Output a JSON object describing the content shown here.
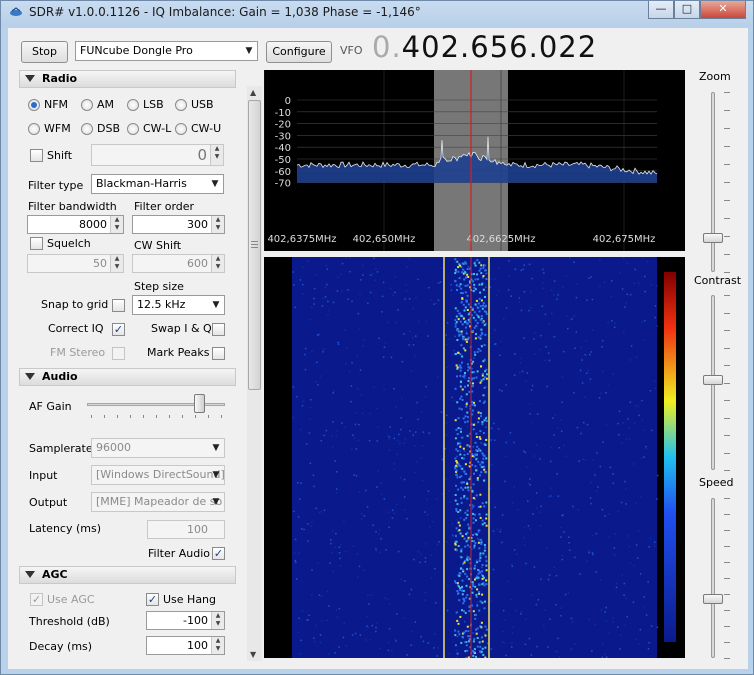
{
  "window": {
    "title": "SDR# v1.0.0.1126 - IQ Imbalance: Gain = 1,038 Phase = -1,146°",
    "minimize": "—",
    "maximize": "□",
    "close": "✕"
  },
  "toolbar": {
    "stop_label": "Stop",
    "device": "FUNcube Dongle Pro",
    "configure_label": "Configure",
    "vfo_label": "VFO",
    "vfo_leading": "0.",
    "vfo_value": "402.656.022"
  },
  "radio": {
    "section_title": "Radio",
    "modes": [
      "NFM",
      "AM",
      "LSB",
      "USB",
      "WFM",
      "DSB",
      "CW-L",
      "CW-U"
    ],
    "selected_mode": "NFM",
    "shift_label": "Shift",
    "shift_value": "0",
    "filter_type_label": "Filter type",
    "filter_type": "Blackman-Harris",
    "filter_bandwidth_label": "Filter bandwidth",
    "filter_bandwidth": "8000",
    "filter_order_label": "Filter order",
    "filter_order": "300",
    "squelch_label": "Squelch",
    "squelch_value": "50",
    "cw_shift_label": "CW Shift",
    "cw_shift_value": "600",
    "step_size_label": "Step size",
    "step_size": "12.5 kHz",
    "snap_to_grid_label": "Snap to grid",
    "correct_iq_label": "Correct IQ",
    "swap_iq_label": "Swap I & Q",
    "fm_stereo_label": "FM Stereo",
    "mark_peaks_label": "Mark Peaks",
    "check_mark": "✓"
  },
  "audio": {
    "section_title": "Audio",
    "af_gain_label": "AF Gain",
    "af_gain_level": 0.85,
    "samplerate_label": "Samplerate",
    "samplerate": "96000",
    "input_label": "Input",
    "input": "[Windows DirectSound]",
    "output_label": "Output",
    "output": "[MME] Mapeador de so",
    "latency_label": "Latency (ms)",
    "latency": "100",
    "filter_audio_label": "Filter Audio"
  },
  "agc": {
    "section_title": "AGC",
    "use_agc_label": "Use AGC",
    "use_hang_label": "Use Hang",
    "threshold_label": "Threshold (dB)",
    "threshold": "-100",
    "decay_label": "Decay (ms)",
    "decay": "100"
  },
  "spectrum": {
    "y_ticks": [
      "0",
      "-10",
      "-20",
      "-30",
      "-40",
      "-50",
      "-60",
      "-70"
    ],
    "freq_labels": [
      "402,6375MHz",
      "402,650MHz",
      "402,6625MHz",
      "402,675MHz"
    ]
  },
  "side_controls": {
    "zoom_label": "Zoom",
    "contrast_label": "Contrast",
    "speed_label": "Speed"
  },
  "colors": {
    "spectrum_fill": "#1d3f8f",
    "filter_band": "#8c8c8c",
    "vfo_marker": "#d22020",
    "waterfall_bg": "#0a1a8c"
  }
}
